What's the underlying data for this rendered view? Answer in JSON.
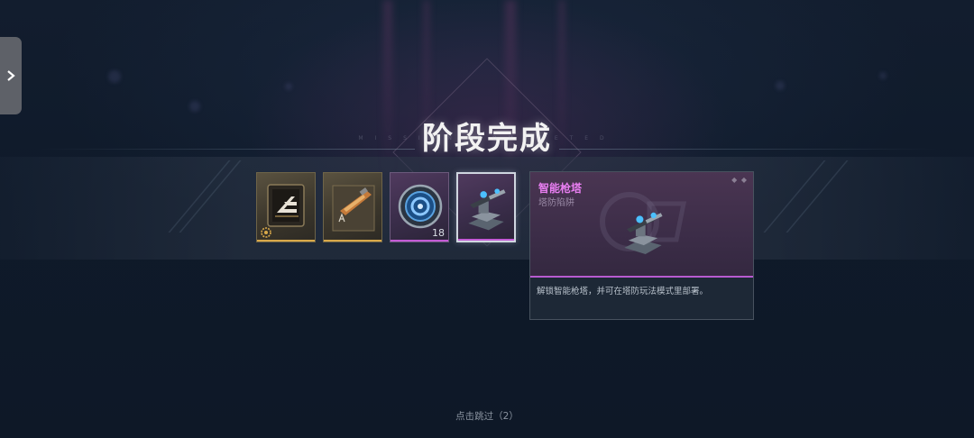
{
  "title": "阶段完成",
  "subtitle": "MISSION COMPLETED",
  "rewards": [
    {
      "name": "emblem-card",
      "rarity": "gold",
      "quantity": ""
    },
    {
      "name": "weapon-blueprint",
      "rarity": "gold",
      "quantity": ""
    },
    {
      "name": "core-chip",
      "rarity": "purple",
      "quantity": "18"
    },
    {
      "name": "smart-turret",
      "rarity": "purple",
      "quantity": "",
      "selected": true
    }
  ],
  "detail": {
    "name": "智能枪塔",
    "type": "塔防陷阱",
    "description": "解锁智能枪塔，并可在塔防玩法模式里部署。",
    "dots": "◆ ◆"
  },
  "skip_hint": "点击跳过（2）",
  "colors": {
    "gold": "#d9a94a",
    "purple": "#c45bd6",
    "name_accent": "#e77ef0"
  },
  "icons": {
    "side_tab": "chevron-right-icon",
    "gold_badge": "gear-badge-icon"
  }
}
